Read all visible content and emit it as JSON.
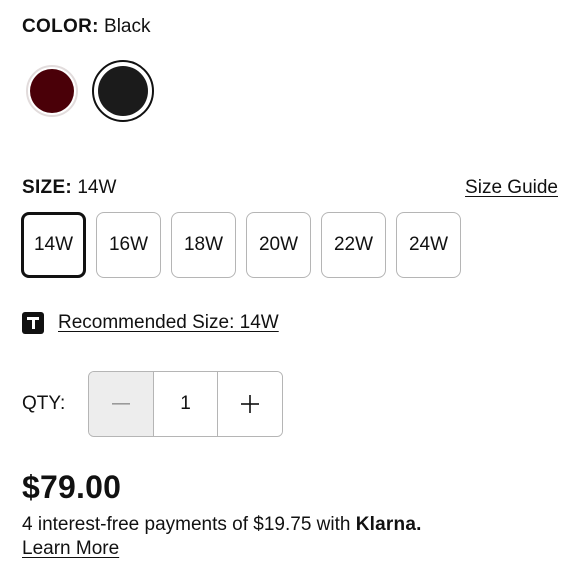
{
  "color": {
    "label": "COLOR:",
    "selected_name": "Black",
    "swatches": [
      {
        "name": "Burgundy",
        "hex": "#4a0008",
        "selected": false
      },
      {
        "name": "Black",
        "hex": "#1b1b1b",
        "selected": true
      }
    ]
  },
  "size": {
    "label": "SIZE:",
    "selected": "14W",
    "guide_link": "Size Guide",
    "options": [
      "14W",
      "16W",
      "18W",
      "20W",
      "22W",
      "24W"
    ]
  },
  "recommended": {
    "icon": "t-logo-icon",
    "text": "Recommended Size: 14W"
  },
  "quantity": {
    "label": "QTY:",
    "value": "1",
    "minus_symbol": "−",
    "plus_symbol": "+"
  },
  "price": {
    "amount": "$79.00"
  },
  "klarna": {
    "text": "4 interest-free payments of $19.75 with",
    "brand": "Klarna.",
    "learn_more": "Learn More"
  },
  "colors": {
    "text": "#111111",
    "border": "#b5b5b5",
    "minus_bg": "#ededed"
  }
}
